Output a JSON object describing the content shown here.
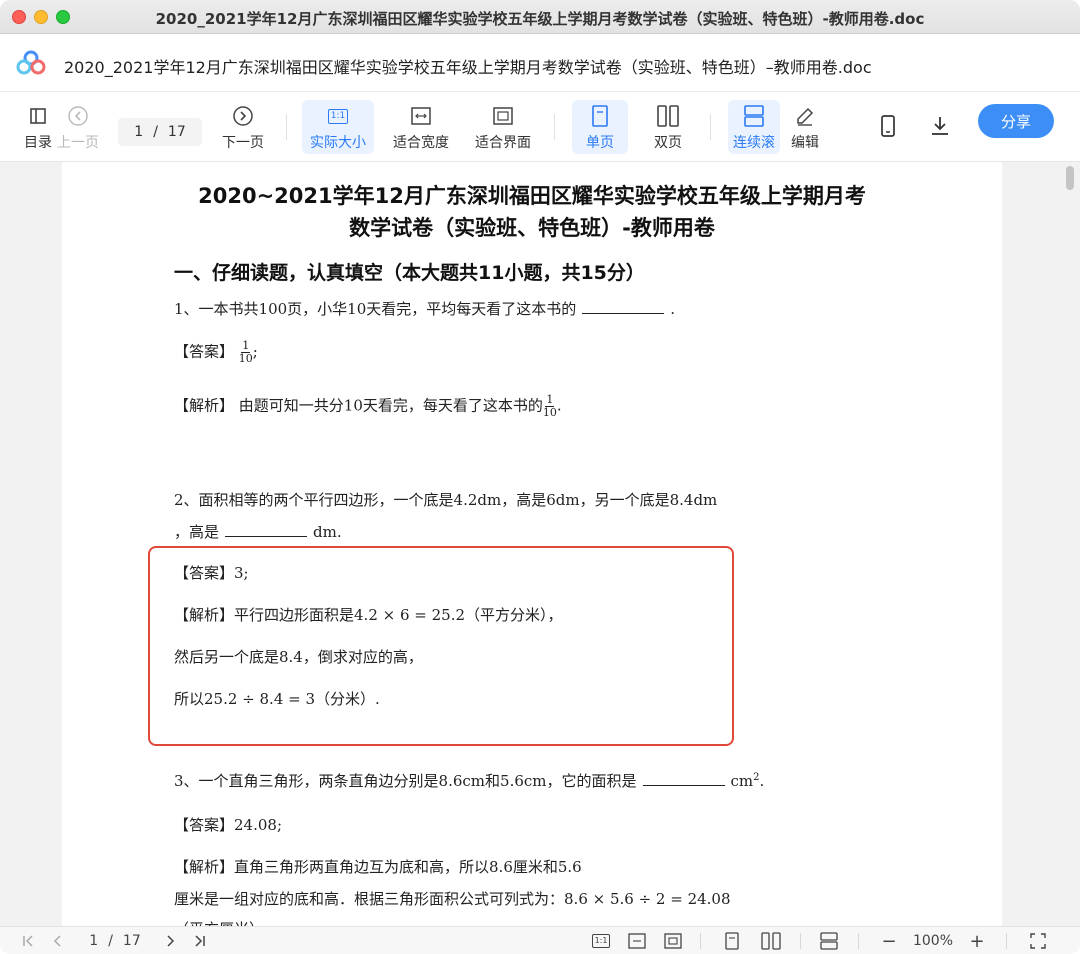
{
  "window": {
    "title": "2020_2021学年12月广东深圳福田区耀华实验学校五年级上学期月考数学试卷（实验班、特色班）-教师用卷.doc"
  },
  "header": {
    "doc_title": "2020_2021学年12月广东深圳福田区耀华实验学校五年级上学期月考数学试卷（实验班、特色班）–教师用卷.doc"
  },
  "toolbar": {
    "toc_label": "目录",
    "prev_label": "上一页",
    "page_current": "1",
    "page_sep": "/",
    "page_total": "17",
    "next_label": "下一页",
    "actual_size_label": "实际大小",
    "actual_size_icon_text": "1:1",
    "fit_width_label": "适合宽度",
    "fit_page_label": "适合界面",
    "single_page_label": "单页",
    "double_page_label": "双页",
    "continuous_label": "连续滚",
    "edit_label": "编辑",
    "share_label": "分享"
  },
  "document": {
    "title_line1": "2020~2021学年12月广东深圳福田区耀华实验学校五年级上学期月考",
    "title_line2": "数学试卷（实验班、特色班）-教师用卷",
    "section1": "一、仔细读题，认真填空（本大题共11小题，共15分）",
    "q1": {
      "stem_a": "1、一本书共100页，小华10天看完，平均每天看了这本书的",
      "stem_b": ".",
      "answer_tag": "【答案】",
      "answer_num": "1",
      "answer_den": "10",
      "answer_tail": ";",
      "analysis_tag": "【解析】",
      "analysis_text": "由题可知一共分10天看完，每天看了这本书的",
      "analysis_num": "1",
      "analysis_den": "10",
      "analysis_tail": "."
    },
    "q2": {
      "stem_line1": "2、面积相等的两个平行四边形，一个底是4.2dm，高是6dm，另一个底是8.4dm",
      "stem_line2_a": "，高是",
      "stem_line2_b": "dm.",
      "answer_tag": "【答案】",
      "answer": "3;",
      "analysis_tag": "【解析】",
      "analysis_line1": "平行四边形面积是4.2 × 6 = 25.2（平方分米），",
      "analysis_line2": "然后另一个底是8.4，倒求对应的高，",
      "analysis_line3": "所以25.2 ÷ 8.4 = 3（分米）."
    },
    "q3": {
      "stem_a": "3、一个直角三角形，两条直角边分别是8.6cm和5.6cm，它的面积是",
      "stem_unit": "cm",
      "stem_sup": "2",
      "stem_tail": ".",
      "answer_tag": "【答案】",
      "answer": "24.08;",
      "analysis_tag": "【解析】",
      "analysis_line1": "直角三角形两直角边互为底和高，所以8.6厘米和5.6",
      "analysis_line2": "厘米是一组对应的底和高．根据三角形面积公式可列式为：8.6 × 5.6 ÷ 2 = 24.08",
      "analysis_line3": "（平方厘米）"
    }
  },
  "bottombar": {
    "page_current": "1",
    "page_sep": "/",
    "page_total": "17",
    "actual_size_icon_text": "1:1",
    "zoom": "100%",
    "minus": "−",
    "plus": "+"
  },
  "colors": {
    "accent": "#3d8ff7",
    "active_bg": "#eaf2ff",
    "highlight_border": "#e0493a"
  }
}
